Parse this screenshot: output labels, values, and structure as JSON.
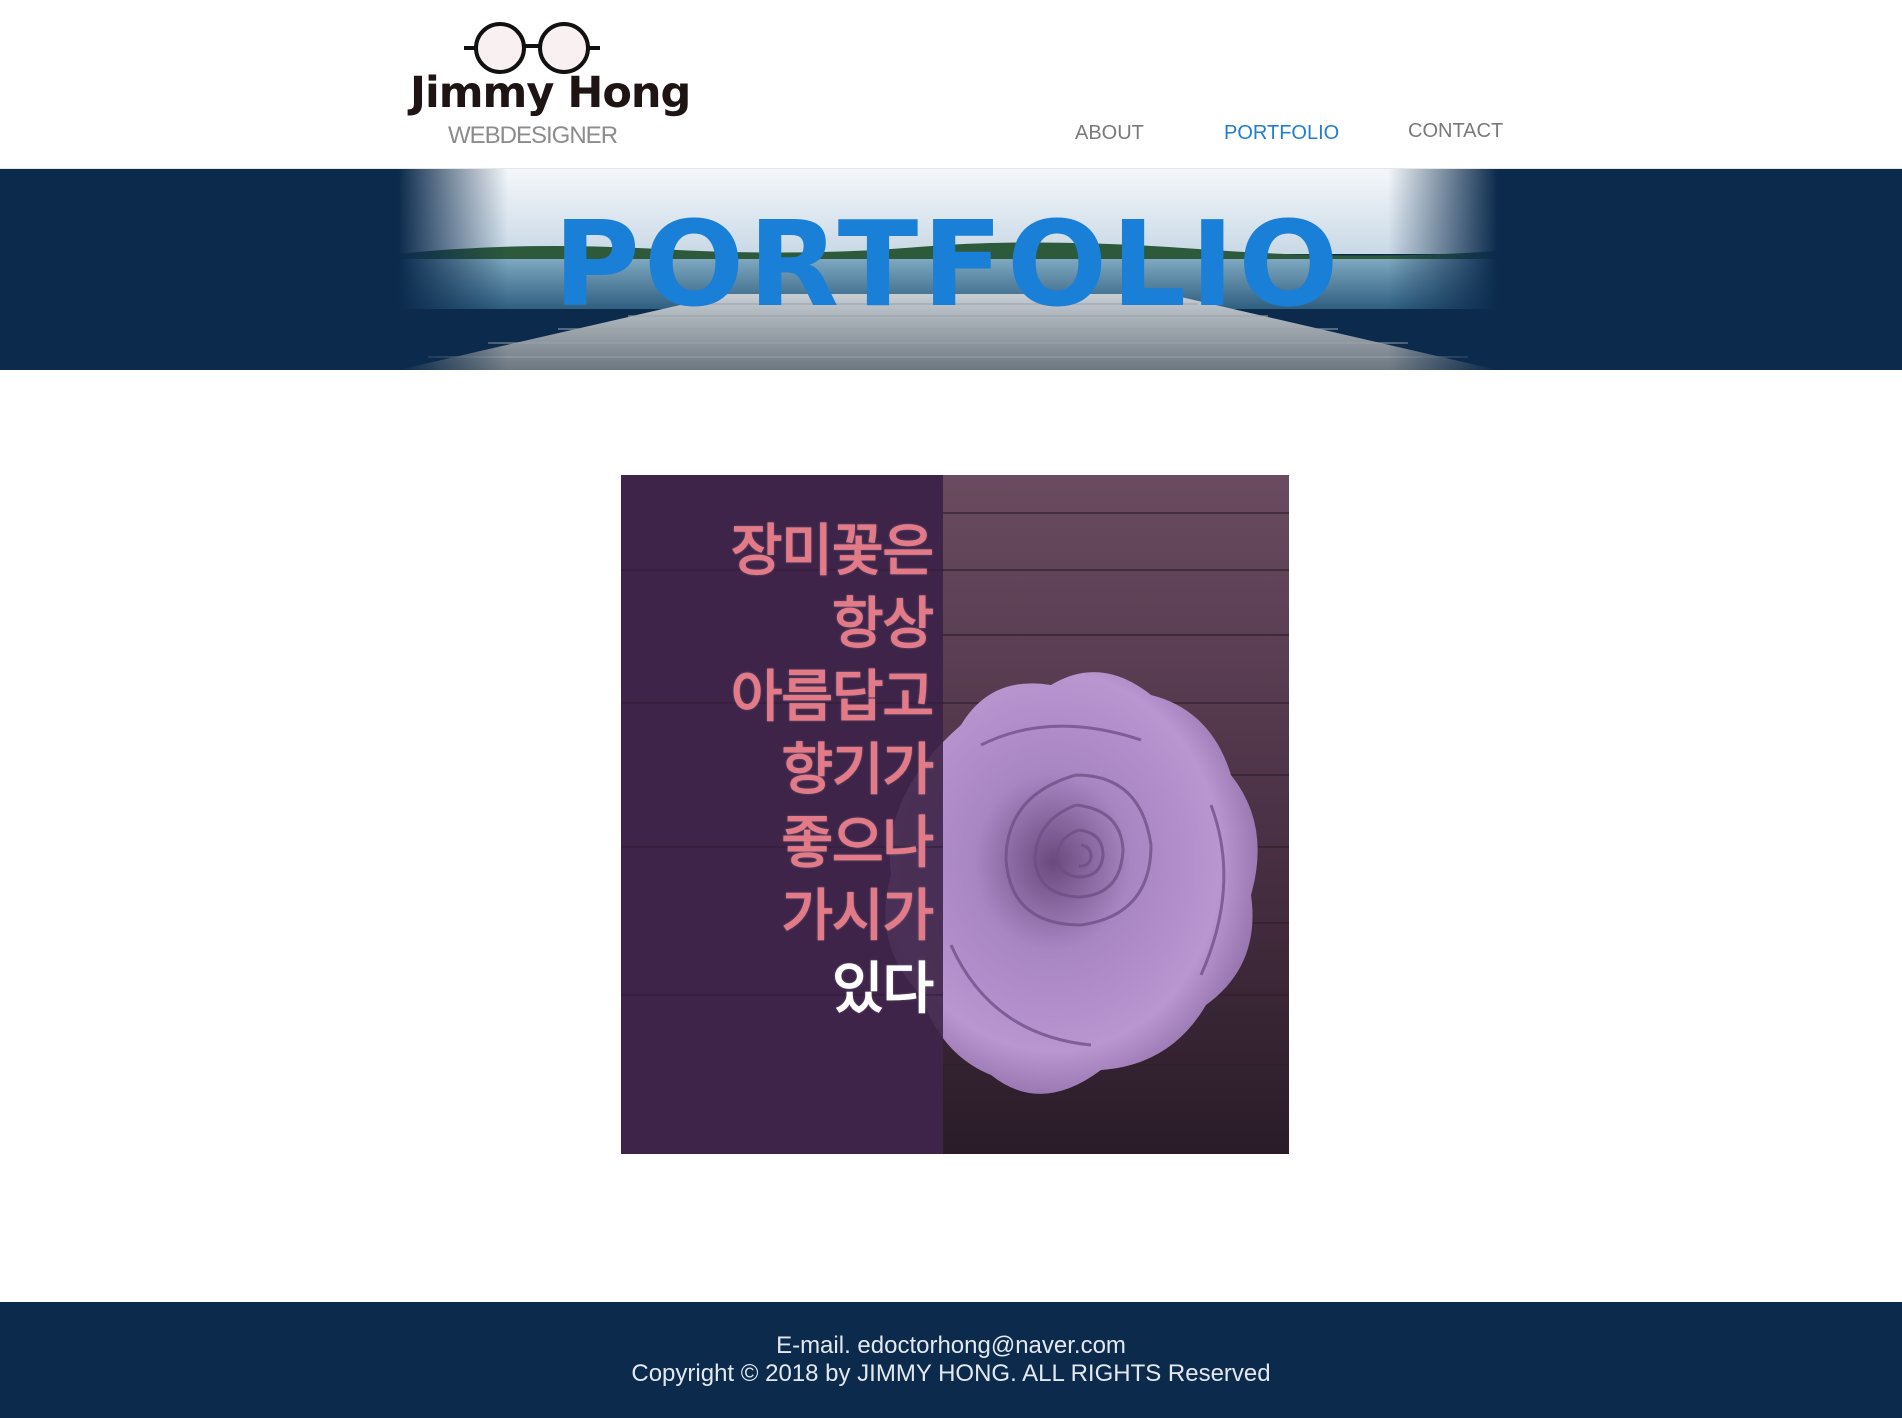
{
  "brand": {
    "name": "Jimmy Hong",
    "tagline": "WEBDESIGNER",
    "logo_icon": "glasses-icon"
  },
  "nav": {
    "items": [
      {
        "label": "ABOUT",
        "active": false
      },
      {
        "label": "PORTFOLIO",
        "active": true
      },
      {
        "label": "CONTACT",
        "active": false
      }
    ]
  },
  "banner": {
    "title": "PORTFOLIO"
  },
  "artwork": {
    "poem": [
      "장미꽃은",
      "항상",
      "아름답고",
      "향기가",
      "좋으나",
      "가시가",
      "있다"
    ]
  },
  "footer": {
    "email": "E-mail. edoctorhong@naver.com",
    "copyright": "Copyright © 2018 by JIMMY HONG. ALL RIGHTS Reserved"
  },
  "colors": {
    "header_bg": "#ffffff",
    "banner_bg": "#0b2a4c",
    "footer_bg": "#0b2a4c",
    "accent": "#1f7dd3",
    "nav_text": "#7a7a7a"
  }
}
